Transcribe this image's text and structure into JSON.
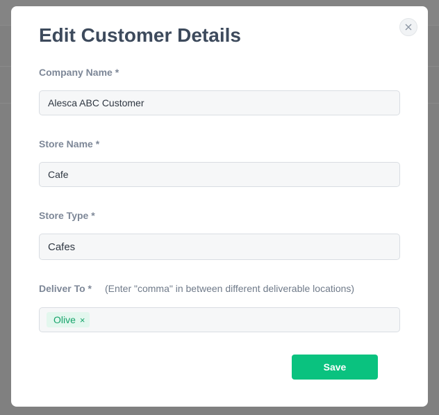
{
  "modal": {
    "title": "Edit Customer Details",
    "close_icon": "close-icon"
  },
  "form": {
    "company_name": {
      "label": "Company Name *",
      "value": "Alesca ABC Customer"
    },
    "store_name": {
      "label": "Store Name *",
      "value": "Cafe"
    },
    "store_type": {
      "label": "Store Type *",
      "value": "Cafes"
    },
    "deliver_to": {
      "label": "Deliver To *",
      "hint": "(Enter \"comma\" in between different deliverable locations)",
      "tags": [
        "Olive"
      ],
      "remove_symbol": "×"
    },
    "save_label": "Save"
  },
  "colors": {
    "primary": "#0ac27f",
    "title": "#3d4a5c",
    "label": "#7d8797",
    "tag_bg": "#e3f7ee",
    "tag_text": "#16a36a",
    "overlay": "#808080"
  }
}
